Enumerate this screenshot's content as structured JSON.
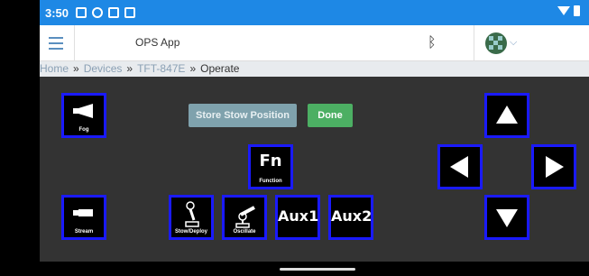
{
  "status": {
    "time": "3:50"
  },
  "app": {
    "title": "OPS App"
  },
  "breadcrumb": {
    "home": "Home",
    "devices": "Devices",
    "device": "TFT-847E",
    "current": "Operate",
    "separator": "»"
  },
  "actions": {
    "store_stow": "Store Stow Position",
    "done": "Done"
  },
  "controls": {
    "fog": "Fog",
    "stream": "Stream",
    "function_big": "Fn",
    "function_cap": "Function",
    "stow": "Stow/Deploy",
    "oscillate": "Oscillate",
    "aux1": "Aux1",
    "aux2": "Aux2"
  },
  "colors": {
    "status_bar": "#1e88e5",
    "button_border": "#1a1aff",
    "panel_bg": "#333333",
    "store_btn": "#7fa2ad",
    "done_btn": "#4caf63"
  },
  "icons": [
    "bluetooth-icon",
    "avatar",
    "chevron-down-icon",
    "hamburger-icon",
    "arrow-up-icon",
    "arrow-down-icon",
    "arrow-left-icon",
    "arrow-right-icon",
    "fog-nozzle-icon",
    "stream-nozzle-icon",
    "stow-icon",
    "oscillate-icon"
  ]
}
